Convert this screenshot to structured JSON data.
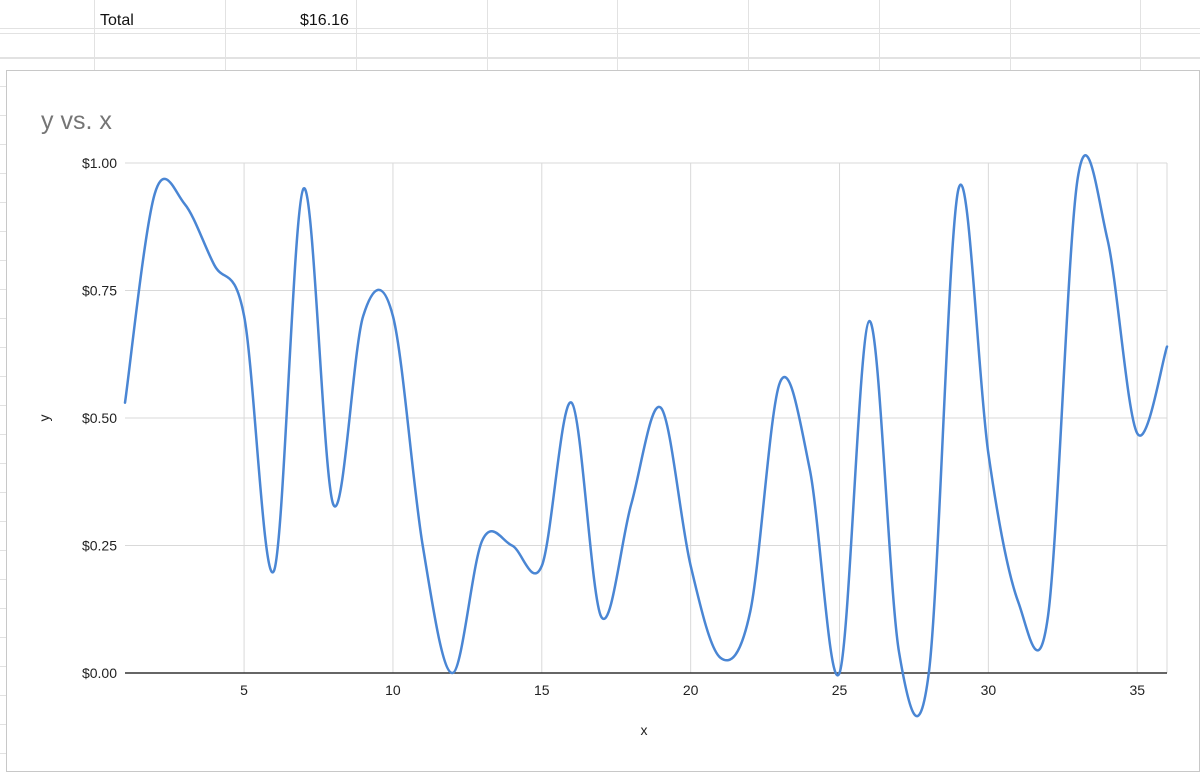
{
  "sheet": {
    "total_label": "Total",
    "total_value": "$16.16"
  },
  "chart_data": {
    "type": "line",
    "title": "y vs. x",
    "xlabel": "x",
    "ylabel": "y",
    "xlim": [
      1,
      36
    ],
    "ylim": [
      0,
      1
    ],
    "x_ticks": [
      5,
      10,
      15,
      20,
      25,
      30,
      35
    ],
    "x_tick_labels": [
      "5",
      "10",
      "15",
      "20",
      "25",
      "30",
      "35"
    ],
    "y_ticks": [
      0,
      0.25,
      0.5,
      0.75,
      1
    ],
    "y_tick_labels": [
      "$0.00",
      "$0.25",
      "$0.50",
      "$0.75",
      "$1.00"
    ],
    "grid": true,
    "legend": "none",
    "line_color": "#4a86d4",
    "x": [
      1,
      2,
      3,
      4,
      5,
      6,
      7,
      8,
      9,
      10,
      11,
      12,
      13,
      14,
      15,
      16,
      17,
      18,
      19,
      20,
      21,
      22,
      23,
      24,
      25,
      26,
      27,
      28,
      29,
      30,
      31,
      32,
      33,
      34,
      35,
      36
    ],
    "y": [
      0.53,
      0.94,
      0.92,
      0.8,
      0.7,
      0.2,
      0.95,
      0.33,
      0.7,
      0.7,
      0.25,
      0.0,
      0.26,
      0.25,
      0.21,
      0.53,
      0.11,
      0.33,
      0.52,
      0.21,
      0.03,
      0.12,
      0.57,
      0.4,
      0.0,
      0.69,
      0.04,
      0.0,
      0.95,
      0.43,
      0.14,
      0.11,
      0.97,
      0.85,
      0.47,
      0.64
    ]
  }
}
